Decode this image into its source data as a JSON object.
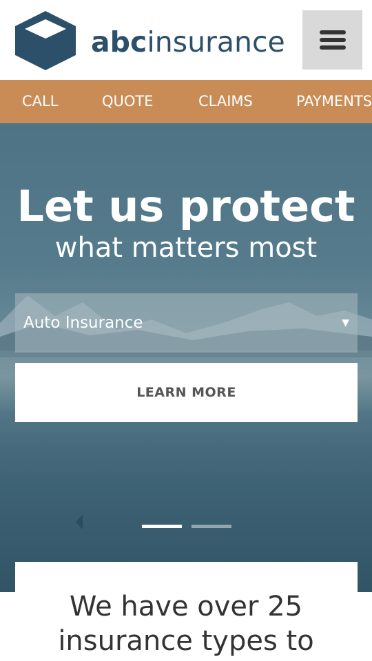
{
  "brand": {
    "name_bold": "abc",
    "name_light": "insurance",
    "color": "#2c5069"
  },
  "menu": {
    "icon": "hamburger-menu-icon"
  },
  "nav": {
    "background": "#c98c56",
    "items": [
      "CALL",
      "QUOTE",
      "CLAIMS",
      "PAYMENTS"
    ]
  },
  "hero": {
    "headline": "Let us protect",
    "subline": "what matters most",
    "select": {
      "value": "Auto Insurance"
    },
    "cta_label": "LEARN MORE",
    "slides": {
      "count": 2,
      "active": 1
    }
  },
  "section": {
    "heading_line1": "We have over 25",
    "heading_line2": "insurance types to"
  }
}
